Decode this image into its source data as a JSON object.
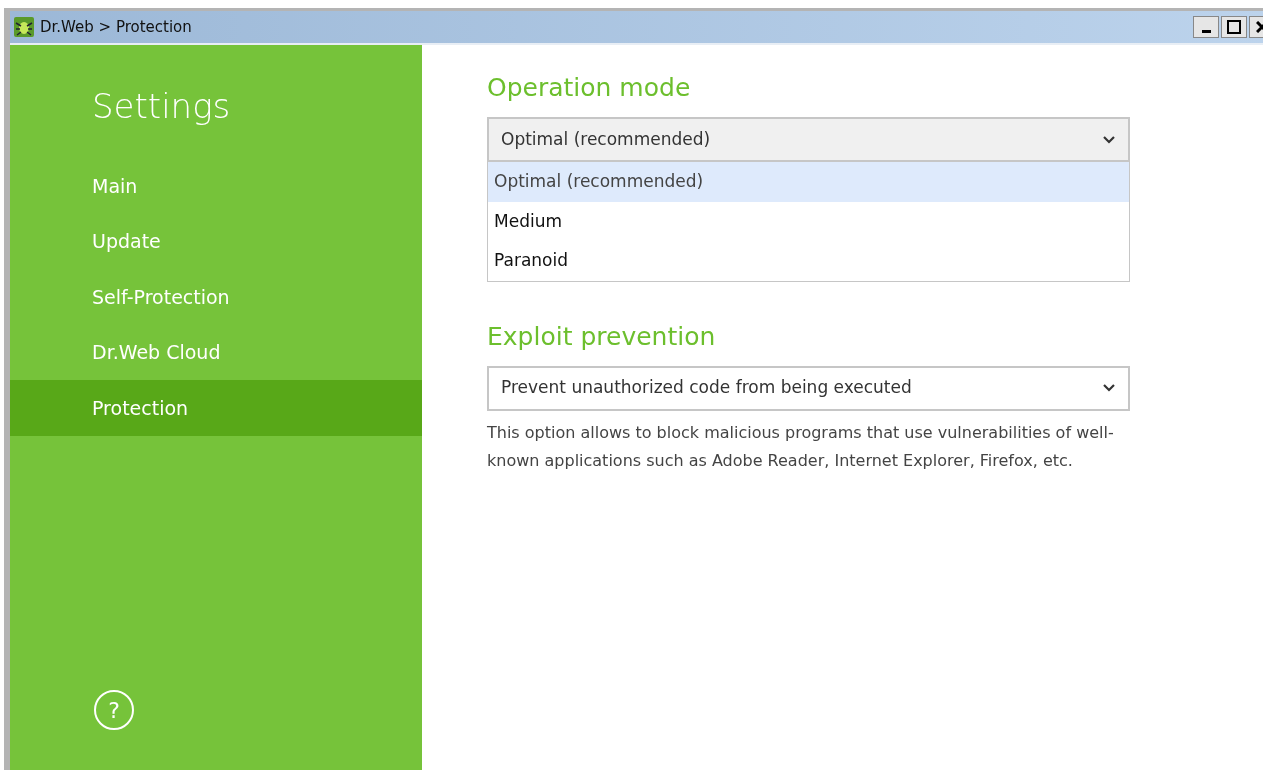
{
  "window": {
    "title": "Dr.Web > Protection"
  },
  "sidebar": {
    "title": "Settings",
    "items": [
      {
        "label": "Main",
        "selected": false
      },
      {
        "label": "Update",
        "selected": false
      },
      {
        "label": "Self-Protection",
        "selected": false
      },
      {
        "label": "Dr.Web Cloud",
        "selected": false
      },
      {
        "label": "Protection",
        "selected": true
      }
    ],
    "help": "?"
  },
  "sections": [
    {
      "heading": "Operation mode",
      "dropdown": {
        "value": "Optimal (recommended)",
        "expanded": true,
        "options": [
          {
            "label": "Optimal (recommended)",
            "selected": true
          },
          {
            "label": "Medium",
            "selected": false
          },
          {
            "label": "Paranoid",
            "selected": false
          }
        ]
      }
    },
    {
      "heading": "Exploit prevention",
      "dropdown": {
        "value": "Prevent unauthorized code from being executed",
        "expanded": false
      },
      "description": "This option allows to block malicious programs that use vulnerabilities of well-known applications such as Adobe Reader, Internet Explorer, Firefox, etc."
    }
  ]
}
